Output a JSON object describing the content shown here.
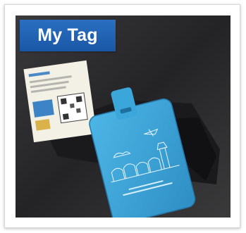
{
  "card": {
    "title": "My Tag"
  },
  "image": {
    "subject": "blue-luggage-tag-photo",
    "tag_color": "#3aa3d6",
    "badge_color": "#1f5fae"
  }
}
